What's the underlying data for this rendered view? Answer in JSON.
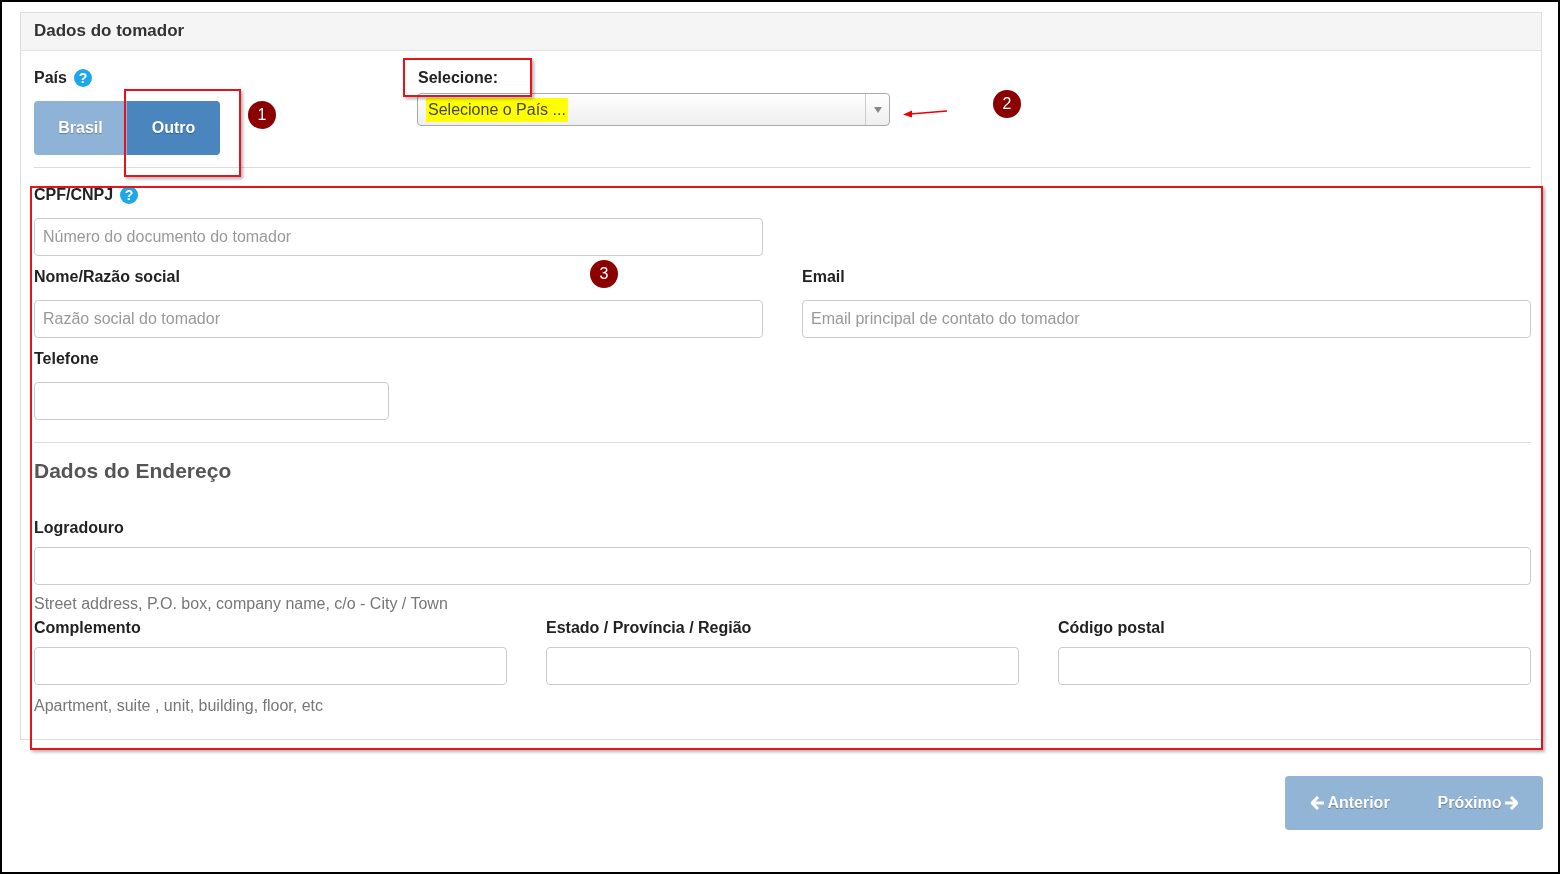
{
  "panel": {
    "title": "Dados do tomador"
  },
  "country": {
    "label": "País",
    "help_icon": "?",
    "options": [
      {
        "label": "Brasil",
        "selected": false
      },
      {
        "label": "Outro",
        "selected": true
      }
    ]
  },
  "select": {
    "label": "Selecione:",
    "value": "Selecione o País ...",
    "highlighted": true
  },
  "field_rows": [
    [
      {
        "label": "CPF/CNPJ",
        "help_icon": "?",
        "placeholder": "Número do documento do tomador"
      }
    ],
    [
      {
        "label": "Nome/Razão social",
        "placeholder": "Razão social do tomador"
      },
      {
        "label": "Email",
        "placeholder": "Email principal de contato do tomador"
      }
    ],
    [
      {
        "label": "Telefone"
      }
    ]
  ],
  "address": {
    "heading": "Dados do Endereço",
    "street": {
      "label": "Logradouro",
      "help": "Street address, P.O. box, company name, c/o - City / Town"
    },
    "fields": [
      {
        "label": "Complemento"
      },
      {
        "label": "Estado / Província / Região"
      },
      {
        "label": "Código postal"
      }
    ],
    "help": "Apartment, suite , unit, building, floor, etc"
  },
  "nav": [
    {
      "label": "Anterior",
      "kind": "prev"
    },
    {
      "label": "Próximo",
      "kind": "next"
    }
  ],
  "annotations": [
    {
      "number": "1"
    },
    {
      "number": "2"
    },
    {
      "number": "3"
    }
  ]
}
